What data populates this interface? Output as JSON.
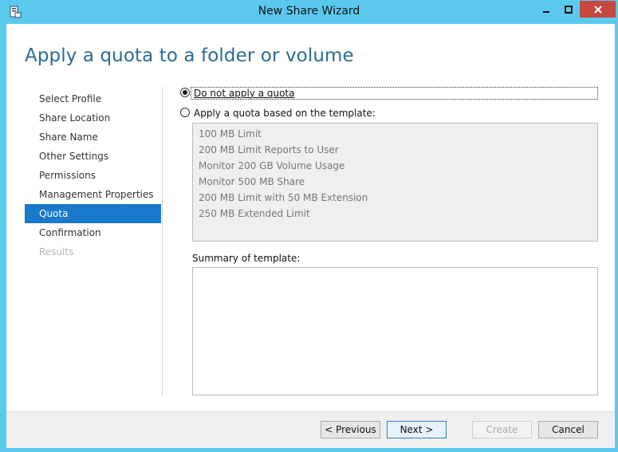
{
  "window": {
    "title": "New Share Wizard"
  },
  "header": {
    "page_title": "Apply a quota to a folder or volume"
  },
  "nav": {
    "items": [
      {
        "label": "Select Profile",
        "state": "normal"
      },
      {
        "label": "Share Location",
        "state": "normal"
      },
      {
        "label": "Share Name",
        "state": "normal"
      },
      {
        "label": "Other Settings",
        "state": "normal"
      },
      {
        "label": "Permissions",
        "state": "normal"
      },
      {
        "label": "Management Properties",
        "state": "normal"
      },
      {
        "label": "Quota",
        "state": "active"
      },
      {
        "label": "Confirmation",
        "state": "normal"
      },
      {
        "label": "Results",
        "state": "disabled"
      }
    ]
  },
  "options": {
    "no_quota_label": "Do not apply a quota",
    "no_quota_checked": true,
    "template_label": "Apply a quota based on the template:",
    "template_checked": false
  },
  "templates": [
    "100 MB Limit",
    "200 MB Limit Reports to User",
    "Monitor 200 GB Volume Usage",
    "Monitor 500 MB Share",
    "200 MB Limit with 50 MB Extension",
    "250 MB Extended Limit"
  ],
  "summary": {
    "label": "Summary of template:",
    "text": ""
  },
  "footer": {
    "previous": "< Previous",
    "next": "Next >",
    "create": "Create",
    "cancel": "Cancel"
  },
  "colors": {
    "titlebar": "#5bc9ee",
    "accent": "#1979ca",
    "title_text": "#2a6b96",
    "close_button": "#c7483f"
  }
}
